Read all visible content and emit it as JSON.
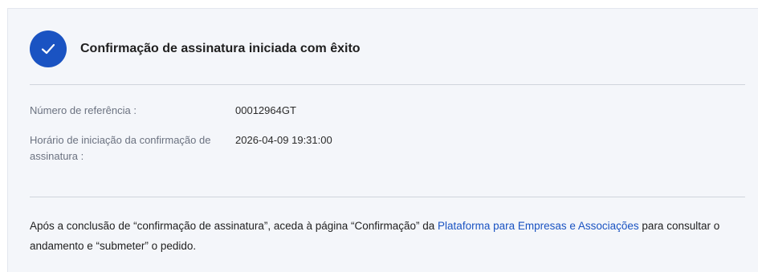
{
  "header": {
    "title": "Confirmação de assinatura iniciada com êxito",
    "icon": "check-circle-icon",
    "accent_color": "#1a53c2"
  },
  "details": [
    {
      "label": "Número de referência :",
      "value": "00012964GT"
    },
    {
      "label": "Horário de iniciação da confirmação de assinatura :",
      "value": "2026-04-09 19:31:00"
    }
  ],
  "notice": {
    "before_link": "Após a conclusão de “confirmação de assinatura”, aceda à página “Confirmação” da ",
    "link_text": "Plataforma para Empresas e Associações",
    "after_link": " para consultar o andamento e “submeter” o pedido."
  }
}
